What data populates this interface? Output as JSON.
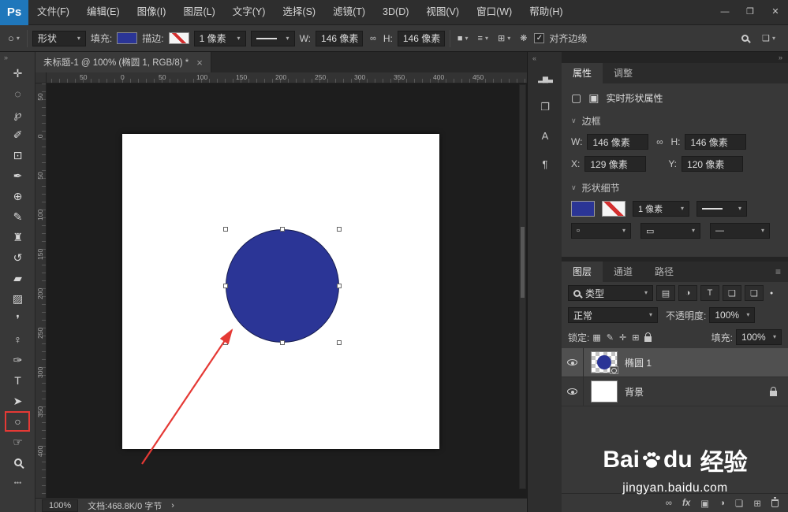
{
  "colors": {
    "shape_fill": "#2b3596",
    "stroke_red": "#d32f2f",
    "highlight_red": "#e53935",
    "logo_blue": "#1f77bb"
  },
  "glyphs": {
    "caret": "▾",
    "section_chevron": "∨"
  },
  "menubar": {
    "logo": "Ps",
    "items": [
      "文件(F)",
      "编辑(E)",
      "图像(I)",
      "图层(L)",
      "文字(Y)",
      "选择(S)",
      "滤镜(T)",
      "3D(D)",
      "视图(V)",
      "窗口(W)",
      "帮助(H)"
    ],
    "minimize": "—",
    "restore": "❐",
    "close": "✕"
  },
  "options_bar": {
    "tool_glyph": "○",
    "mode_value": "形状",
    "fill_label": "填充:",
    "stroke_label": "描边:",
    "stroke_width_value": "1 像素",
    "w_label": "W:",
    "w_value": "146 像素",
    "link_glyph": "∞",
    "h_label": "H:",
    "h_value": "146 像素",
    "path_ops_glyph": "■",
    "align_glyph": "≡",
    "extras_glyph": "⊞",
    "gear_glyph": "❋",
    "check_glyph": "✓",
    "align_edges_label": "对齐边缘",
    "workspace_glyph": "❑"
  },
  "toolbar": {
    "collapse_glyph": "»",
    "tools": [
      {
        "name": "move-tool",
        "glyph": "✛"
      },
      {
        "name": "ellipse-marquee-tool",
        "glyph": "◌"
      },
      {
        "name": "lasso-tool",
        "glyph": "℘"
      },
      {
        "name": "quick-selection-tool",
        "glyph": "✐"
      },
      {
        "name": "crop-tool",
        "glyph": "⊡"
      },
      {
        "name": "eyedropper-tool",
        "glyph": "✒"
      },
      {
        "name": "healing-brush-tool",
        "glyph": "⊕"
      },
      {
        "name": "brush-tool",
        "glyph": "✎"
      },
      {
        "name": "clone-stamp-tool",
        "glyph": "♜"
      },
      {
        "name": "history-brush-tool",
        "glyph": "↺"
      },
      {
        "name": "eraser-tool",
        "glyph": "▰"
      },
      {
        "name": "gradient-tool",
        "glyph": "▨"
      },
      {
        "name": "blur-tool",
        "glyph": "❜"
      },
      {
        "name": "dodge-tool",
        "glyph": "♀"
      },
      {
        "name": "pen-tool",
        "glyph": "✑"
      },
      {
        "name": "type-tool",
        "glyph": "T"
      },
      {
        "name": "path-selection-tool",
        "glyph": "➤"
      },
      {
        "name": "ellipse-tool",
        "glyph": "○",
        "highlighted": true
      },
      {
        "name": "hand-tool",
        "glyph": "☞"
      },
      {
        "name": "zoom-tool",
        "glyph": ""
      },
      {
        "name": "more-tools",
        "glyph": "•••"
      }
    ]
  },
  "tabbar": {
    "doc_title": "未标题-1 @ 100% (椭圆 1, RGB/8) *",
    "close_glyph": "×"
  },
  "rulers": {
    "horizontal": [
      "50",
      "0",
      "50",
      "100",
      "150",
      "200",
      "250",
      "300",
      "350",
      "400",
      "450"
    ],
    "vertical": [
      "50",
      "0",
      "50",
      "100",
      "150",
      "200",
      "250",
      "300",
      "350",
      "400"
    ]
  },
  "statusbar": {
    "zoom": "100%",
    "doc_info": "文档:468.8K/0 字节",
    "chevron": "›"
  },
  "panel_strip": {
    "collapse_glyph": "«",
    "icons": [
      {
        "name": "histogram-panel-icon",
        "glyph": "▂▆▃"
      },
      {
        "name": "clone-source-panel-icon",
        "glyph": "❐"
      },
      {
        "name": "character-panel-icon",
        "glyph": "A"
      },
      {
        "name": "paragraph-panel-icon",
        "glyph": "¶"
      }
    ]
  },
  "properties_panel": {
    "tab_properties": "属性",
    "tab_adjustments": "调整",
    "shape_icon_glyph": "▢",
    "mask_icon_glyph": "▣",
    "header_title": "实时形状属性",
    "border_section": "边框",
    "w_label": "W:",
    "w_value": "146 像素",
    "h_label": "H:",
    "h_value": "146 像素",
    "link_glyph": "∞",
    "x_label": "X:",
    "x_value": "129 像素",
    "y_label": "Y:",
    "y_value": "120 像素",
    "detail_section": "形状细节",
    "stroke_width_value": "1 像素",
    "corner_glyph1": "▫",
    "corner_glyph2": "▭",
    "corner_glyph3": "—"
  },
  "layers_panel": {
    "tab_layers": "图层",
    "tab_channels": "通道",
    "tab_paths": "路径",
    "menu_glyph": "≡",
    "filter_value": "类型",
    "filter_icons": [
      {
        "name": "filter-image-icon",
        "glyph": "▤"
      },
      {
        "name": "filter-adjustment-icon",
        "glyph": "◑"
      },
      {
        "name": "filter-type-icon",
        "glyph": "T"
      },
      {
        "name": "filter-shape-icon",
        "glyph": "❑"
      },
      {
        "name": "filter-smart-object-icon",
        "glyph": "❏"
      }
    ],
    "filter_dot_glyph": "●",
    "blend_mode": "正常",
    "opacity_label": "不透明度:",
    "opacity_value": "100%",
    "lock_label": "锁定:",
    "lock_icons": [
      {
        "name": "lock-transparency-icon",
        "glyph": "▦"
      },
      {
        "name": "lock-pixels-icon",
        "glyph": "✎"
      },
      {
        "name": "lock-position-icon",
        "glyph": "✛"
      },
      {
        "name": "lock-artboard-icon",
        "glyph": "⊞"
      }
    ],
    "fill_label": "填充:",
    "fill_value": "100%",
    "layer1_name": "椭圆 1",
    "layer2_name": "背景",
    "bottom_icons": [
      {
        "name": "link-layers-icon",
        "glyph": "∞"
      },
      {
        "name": "layer-effects-icon",
        "glyph": "fx"
      },
      {
        "name": "layer-mask-icon",
        "glyph": "▣"
      },
      {
        "name": "adjustment-layer-icon",
        "glyph": "◑"
      },
      {
        "name": "layer-group-icon",
        "glyph": "❏"
      },
      {
        "name": "new-layer-icon",
        "glyph": "⊞"
      }
    ]
  },
  "watermark": {
    "brand_prefix": "Bai",
    "brand_suffix": "du",
    "brand_cn": "经验",
    "url": "jingyan.baidu.com"
  }
}
